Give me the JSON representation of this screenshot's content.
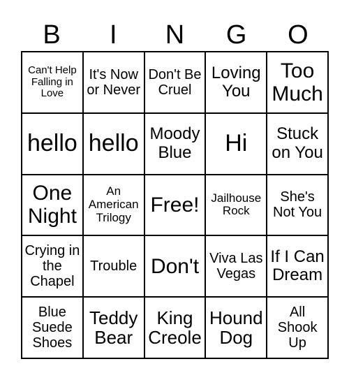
{
  "header": {
    "letters": [
      "B",
      "I",
      "N",
      "G",
      "O"
    ]
  },
  "cells": [
    "Can't Help Falling in Love",
    "It's Now or Never",
    "Don't Be Cruel",
    "Loving You",
    "Too Much",
    "hello",
    "hello",
    "Moody Blue",
    "Hi",
    "Stuck on You",
    "One Night",
    "An American Trilogy",
    "Free!",
    "Jailhouse Rock",
    "She's Not You",
    "Crying in the Chapel",
    "Trouble",
    "Don't",
    "Viva Las Vegas",
    "If I Can Dream",
    "Blue Suede Shoes",
    "Teddy Bear",
    "King Creole",
    "Hound Dog",
    "All Shook Up"
  ]
}
